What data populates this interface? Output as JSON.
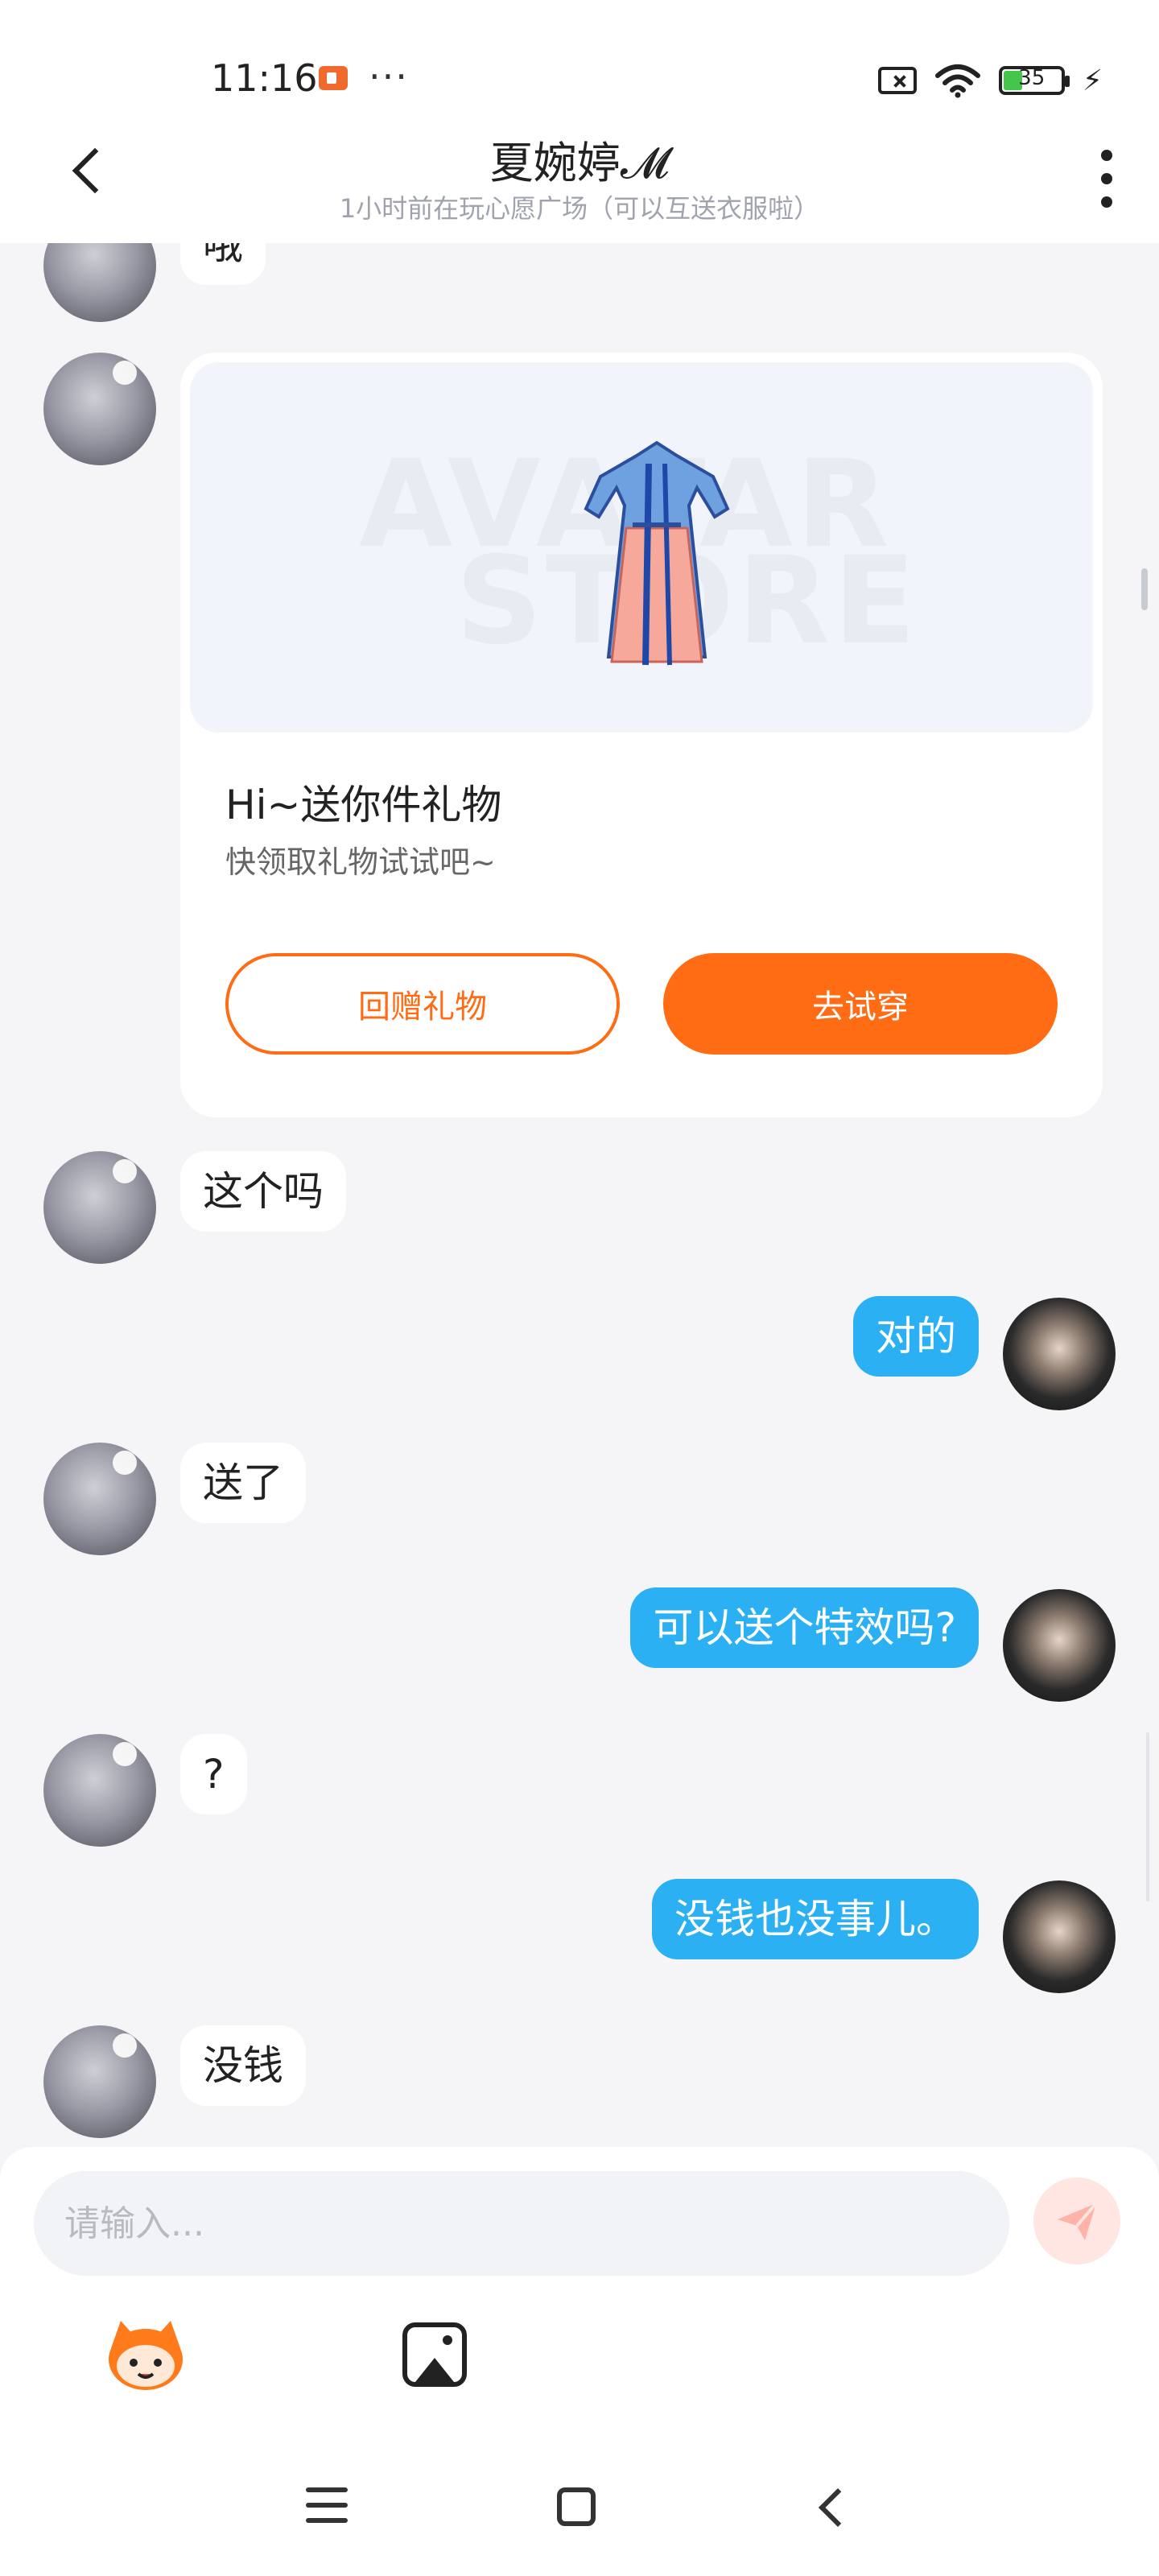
{
  "status_bar": {
    "time": "11:16",
    "dots": "···",
    "battery_level": "35",
    "battery_color": "#44c54b"
  },
  "header": {
    "title": "夏婉婷𝓜",
    "subtitle": "1小时前在玩心愿广场（可以互送衣服啦）"
  },
  "gift_card": {
    "watermark_line1": "AVATAR",
    "watermark_line2": "STORE",
    "title": "Hi~送你件礼物",
    "description": "快领取礼物试试吧~",
    "return_gift_label": "回赠礼物",
    "try_on_label": "去试穿",
    "accent_color": "#ff6c14"
  },
  "messages": [
    {
      "sender": "other",
      "text": "哦"
    },
    {
      "sender": "other",
      "text": "这个吗"
    },
    {
      "sender": "me",
      "text": "对的"
    },
    {
      "sender": "other",
      "text": "送了"
    },
    {
      "sender": "me",
      "text": "可以送个特效吗?"
    },
    {
      "sender": "other",
      "text": "?"
    },
    {
      "sender": "me",
      "text": "没钱也没事儿。"
    },
    {
      "sender": "other",
      "text": "没钱"
    }
  ],
  "composer": {
    "placeholder": "请输入...",
    "outgoing_bubble_color": "#2bb1f3"
  }
}
